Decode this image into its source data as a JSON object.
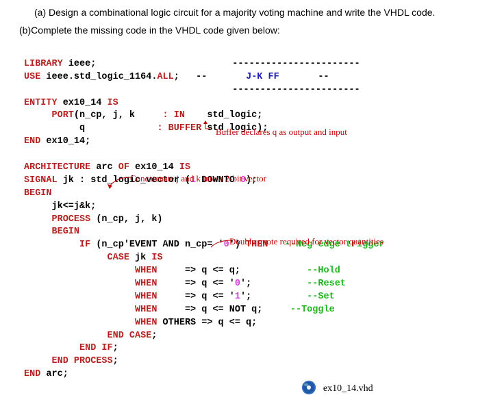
{
  "questions": {
    "a": "(a)  Design a combinational logic circuit for a majority voting machine and write the VHDL code.",
    "b": "(b)Complete the missing code in the VHDL code given below:"
  },
  "code": {
    "l1_lib": "LIBRARY",
    "l1_ieee": " ieee;",
    "l2_use": "USE",
    "l2_pkg": " ieee.std_logic_1164.",
    "l2_all": "ALL",
    "l2_semi": ";",
    "l2_dash1": "   --",
    "l2_jk": "       J-K FF",
    "l2_dash2": "       --",
    "dashesTop": "   -----------------------",
    "dashesBot": "   -----------------------",
    "l3_entity": "ENTITY",
    "l3_name": " ex10_14 ",
    "l3_is": "IS",
    "l4_port": "     PORT",
    "l4_args": "(n_cp, j, k",
    "l4_in": "     : IN",
    "l4_type": "    std_logic;",
    "l5_q": "          q",
    "l5_buf": "             : BUFFER",
    "l5_type": " std_logic);",
    "l6_end": "END",
    "l6_name": " ex10_14;",
    "l7_arch": "ARCHITECTURE",
    "l7_arc": " arc ",
    "l7_of": "OF",
    "l7_ex": " ex10_14 ",
    "l7_is": "IS",
    "l8_sig": "SIGNAL",
    "l8_decl": " jk : std_logic_vector (",
    "l8_1": "1",
    "l8_dto": " DOWNTO ",
    "l8_0": "0",
    "l8_end": ");",
    "l9_begin": "BEGIN",
    "l10": "     jk<=j&k;",
    "l11_proc": "     PROCESS",
    "l11_args": " (n_cp, j, k)",
    "l12_begin": "     BEGIN",
    "l13_if": "          IF",
    "l13_cond": " (n_cp'EVENT AND n_cp= '",
    "l13_0": "0",
    "l13_then": "') ",
    "l13_thenk": "THEN",
    "l13_cmt": "   --Neg edge trigger",
    "l14_case": "               CASE",
    "l14_jk": " jk ",
    "l14_is": "IS",
    "l15_when": "                    WHEN     ",
    "l15_act": "=> q <= q;",
    "l15_cmt": "            --Hold",
    "l16_when": "                    WHEN     ",
    "l16_act": "=> q <= '",
    "l16_0": "0",
    "l16_end": "';",
    "l16_cmt": "          --Reset",
    "l17_when": "                    WHEN     ",
    "l17_act": "=> q <= '",
    "l17_1": "1",
    "l17_end": "';",
    "l17_cmt": "          --Set",
    "l18_when": "                    WHEN     ",
    "l18_act": "=> q <= NOT q;",
    "l18_cmt": "     --Toggle",
    "l19_when": "                    WHEN",
    "l19_oth": " OTHERS ",
    "l19_act": "=> q <= q;",
    "l20_endcase": "               END CASE",
    "l20_semi": ";",
    "l21_endif": "          END IF",
    "l21_semi": ";",
    "l22_endproc": "     END PROCESS",
    "l22_semi": ";",
    "l23_end": "END",
    "l23_arc": " arc;"
  },
  "annotations": {
    "buffer": "Buffer declares q as output and input",
    "concat": "Concatenate j and k into a 2-bit vector",
    "dquote": "Double quote required for vector quantities"
  },
  "file": {
    "name": "ex10_14.vhd"
  }
}
